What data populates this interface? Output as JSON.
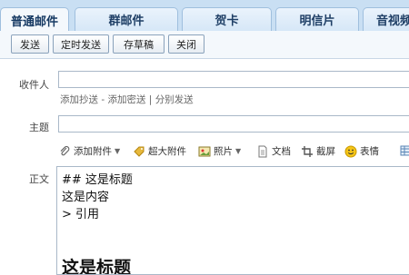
{
  "tabs": [
    "普通邮件",
    "群邮件",
    "贺卡",
    "明信片",
    "音视频"
  ],
  "toolbar": {
    "send": "发送",
    "schedule": "定时发送",
    "draft": "存草稿",
    "close": "关闭"
  },
  "form": {
    "to_label": "收件人",
    "add_cc": "添加抄送",
    "sep1": " - ",
    "add_bcc": "添加密送",
    "sep2": " | ",
    "separate_send": "分别发送",
    "subject_label": "主题",
    "body_label": "正文"
  },
  "editor_toolbar": {
    "attach": "添加附件",
    "big_attach": "超大附件",
    "photo": "照片",
    "doc": "文档",
    "screenshot": "截屏",
    "emoji": "表情"
  },
  "editor": {
    "lines": [
      "## 这是标题",
      "这是内容",
      "> 引用"
    ],
    "heading": "这是标题"
  },
  "colors": {
    "tab_bar": "#c9dff3",
    "tab_text": "#1f3f66",
    "link_text": "#666666"
  }
}
